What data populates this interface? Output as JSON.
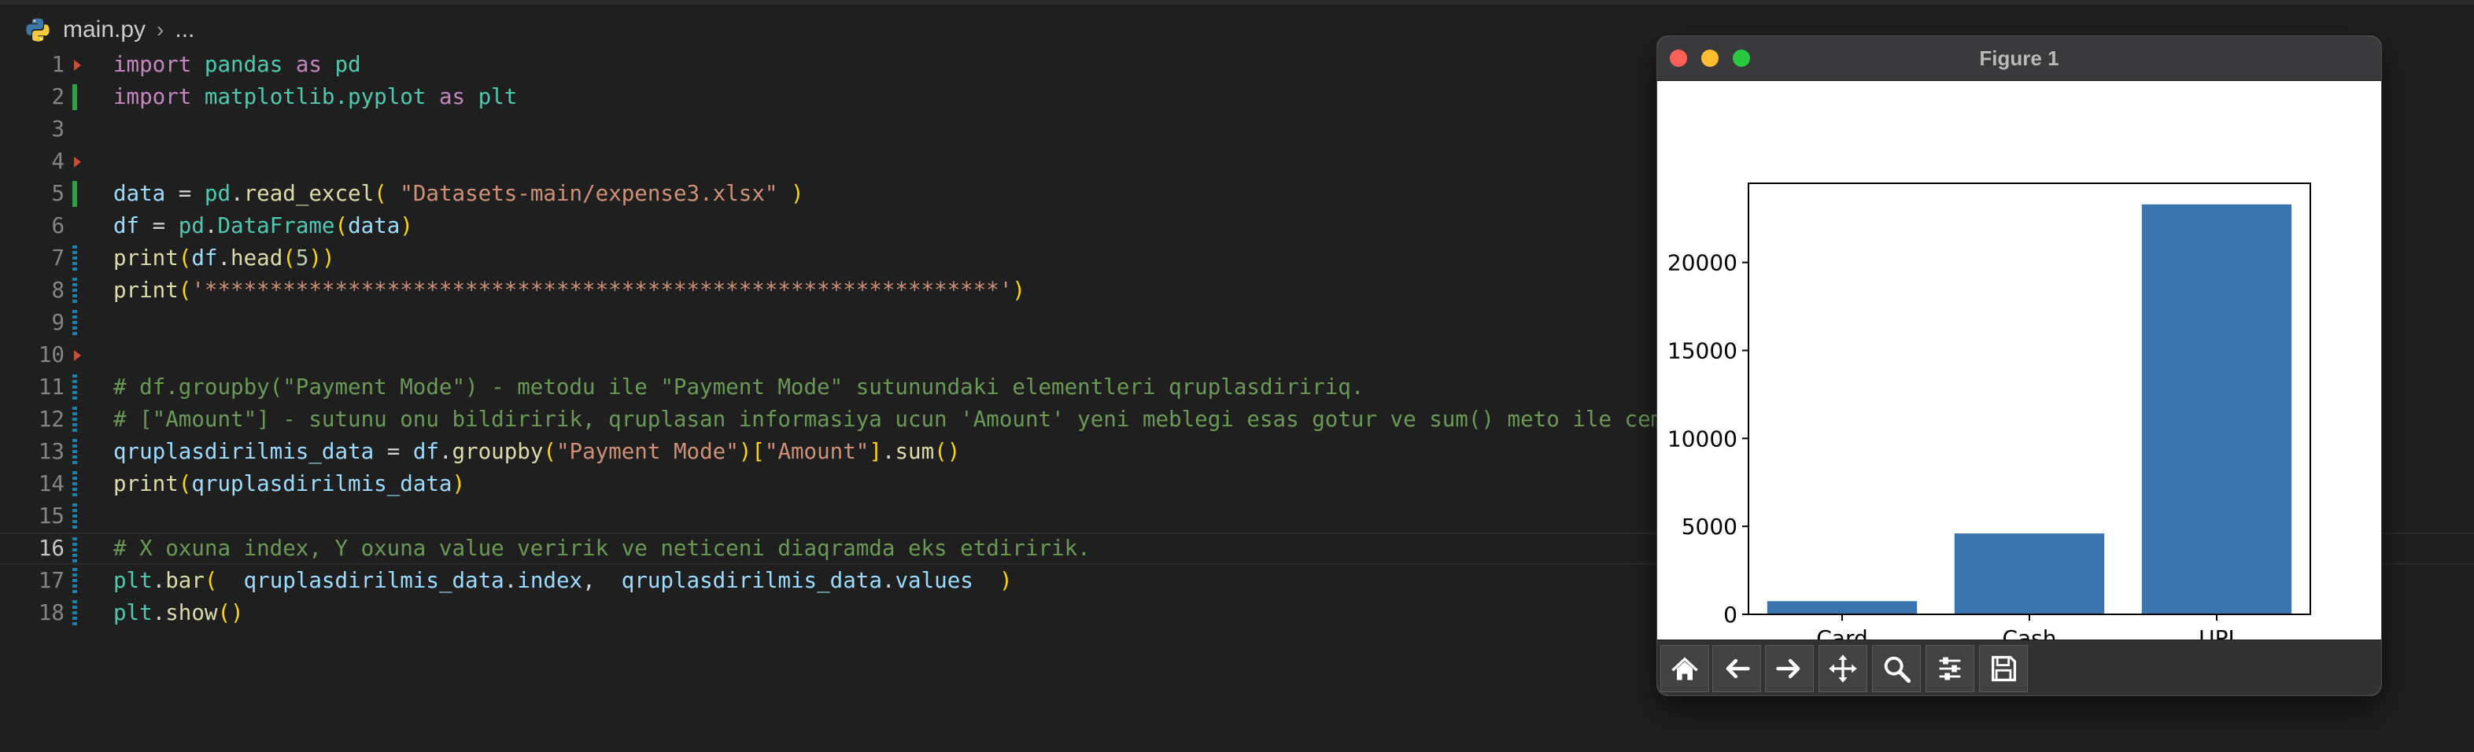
{
  "breadcrumb": {
    "file": "main.py",
    "rest": "..."
  },
  "editor": {
    "lines": [
      {
        "n": "1",
        "gutter": "deleted",
        "tokens": [
          [
            "kw",
            "import"
          ],
          [
            "pn",
            " "
          ],
          [
            "mod",
            "pandas"
          ],
          [
            "pn",
            " "
          ],
          [
            "kw",
            "as"
          ],
          [
            "pn",
            " "
          ],
          [
            "mod",
            "pd"
          ]
        ]
      },
      {
        "n": "2",
        "gutter": "added",
        "tokens": [
          [
            "kw",
            "import"
          ],
          [
            "pn",
            " "
          ],
          [
            "mod",
            "matplotlib.pyplot"
          ],
          [
            "pn",
            " "
          ],
          [
            "kw",
            "as"
          ],
          [
            "pn",
            " "
          ],
          [
            "mod",
            "plt"
          ]
        ]
      },
      {
        "n": "3",
        "gutter": "",
        "tokens": []
      },
      {
        "n": "4",
        "gutter": "deleted",
        "tokens": []
      },
      {
        "n": "5",
        "gutter": "added",
        "tokens": [
          [
            "var",
            "data"
          ],
          [
            "pn",
            " = "
          ],
          [
            "mod",
            "pd"
          ],
          [
            "pn",
            "."
          ],
          [
            "fn",
            "read_excel"
          ],
          [
            "br",
            "("
          ],
          [
            "pn",
            " "
          ],
          [
            "str",
            "\"Datasets-main/expense3.xlsx\""
          ],
          [
            "pn",
            " "
          ],
          [
            "br",
            ")"
          ]
        ]
      },
      {
        "n": "6",
        "gutter": "",
        "tokens": [
          [
            "var",
            "df"
          ],
          [
            "pn",
            " = "
          ],
          [
            "mod",
            "pd"
          ],
          [
            "pn",
            "."
          ],
          [
            "mod",
            "DataFrame"
          ],
          [
            "br",
            "("
          ],
          [
            "var",
            "data"
          ],
          [
            "br",
            ")"
          ]
        ]
      },
      {
        "n": "7",
        "gutter": "modified",
        "tokens": [
          [
            "fn",
            "print"
          ],
          [
            "br",
            "("
          ],
          [
            "var",
            "df"
          ],
          [
            "pn",
            "."
          ],
          [
            "fn",
            "head"
          ],
          [
            "br",
            "("
          ],
          [
            "num",
            "5"
          ],
          [
            "br",
            "))"
          ]
        ]
      },
      {
        "n": "8",
        "gutter": "modified",
        "tokens": [
          [
            "fn",
            "print"
          ],
          [
            "br",
            "("
          ],
          [
            "str",
            "'*************************************************************'"
          ],
          [
            "br",
            ")"
          ]
        ]
      },
      {
        "n": "9",
        "gutter": "modified",
        "tokens": []
      },
      {
        "n": "10",
        "gutter": "deleted",
        "tokens": []
      },
      {
        "n": "11",
        "gutter": "modified",
        "tokens": [
          [
            "cm",
            "# df.groupby(\"Payment Mode\") - metodu ile \"Payment Mode\" sutunundaki elementleri qruplasdiririq."
          ]
        ]
      },
      {
        "n": "12",
        "gutter": "modified",
        "tokens": [
          [
            "cm",
            "# [\"Amount\"] - sutunu onu bildiririk, qruplasan informasiya ucun 'Amount' yeni meblegi esas gotur ve sum() meto ile cemle."
          ]
        ]
      },
      {
        "n": "13",
        "gutter": "modified",
        "tokens": [
          [
            "var",
            "qruplasdirilmis_data"
          ],
          [
            "pn",
            " = "
          ],
          [
            "var",
            "df"
          ],
          [
            "pn",
            "."
          ],
          [
            "fn",
            "groupby"
          ],
          [
            "br",
            "("
          ],
          [
            "str",
            "\"Payment Mode\""
          ],
          [
            "br",
            ")"
          ],
          [
            "br",
            "["
          ],
          [
            "str",
            "\"Amount\""
          ],
          [
            "br",
            "]"
          ],
          [
            "pn",
            "."
          ],
          [
            "fn",
            "sum"
          ],
          [
            "br",
            "()"
          ]
        ]
      },
      {
        "n": "14",
        "gutter": "modified",
        "tokens": [
          [
            "fn",
            "print"
          ],
          [
            "br",
            "("
          ],
          [
            "var",
            "qruplasdirilmis_data"
          ],
          [
            "br",
            ")"
          ]
        ]
      },
      {
        "n": "15",
        "gutter": "modified",
        "tokens": []
      },
      {
        "n": "16",
        "gutter": "modified",
        "current": true,
        "tokens": [
          [
            "cm",
            "# X oxuna index, Y oxuna value veririk ve neticeni diaqramda eks etdiririk."
          ]
        ]
      },
      {
        "n": "17",
        "gutter": "modified",
        "tokens": [
          [
            "mod",
            "plt"
          ],
          [
            "pn",
            "."
          ],
          [
            "fn",
            "bar"
          ],
          [
            "br",
            "("
          ],
          [
            "pn",
            "  "
          ],
          [
            "var",
            "qruplasdirilmis_data"
          ],
          [
            "pn",
            "."
          ],
          [
            "var",
            "index"
          ],
          [
            "pn",
            ",  "
          ],
          [
            "var",
            "qruplasdirilmis_data"
          ],
          [
            "pn",
            "."
          ],
          [
            "var",
            "values"
          ],
          [
            "pn",
            "  "
          ],
          [
            "br",
            ")"
          ]
        ]
      },
      {
        "n": "18",
        "gutter": "modified",
        "tokens": [
          [
            "mod",
            "plt"
          ],
          [
            "pn",
            "."
          ],
          [
            "fn",
            "show"
          ],
          [
            "br",
            "()"
          ]
        ]
      }
    ]
  },
  "figure": {
    "title": "Figure 1",
    "toolbar": [
      {
        "name": "home-icon"
      },
      {
        "name": "arrow-left-icon"
      },
      {
        "name": "arrow-right-icon"
      },
      {
        "name": "pan-move-icon"
      },
      {
        "name": "zoom-magnifier-icon"
      },
      {
        "name": "configure-sliders-icon"
      },
      {
        "name": "save-icon"
      }
    ]
  },
  "chart_data": {
    "type": "bar",
    "categories": [
      "Card",
      "Cash",
      "UPI"
    ],
    "values": [
      750,
      4600,
      23300
    ],
    "yticks": [
      0,
      5000,
      10000,
      15000,
      20000
    ],
    "ylim": [
      0,
      24500
    ],
    "bar_color": "#3a75af",
    "title": "",
    "xlabel": "",
    "ylabel": "",
    "grid": false
  }
}
